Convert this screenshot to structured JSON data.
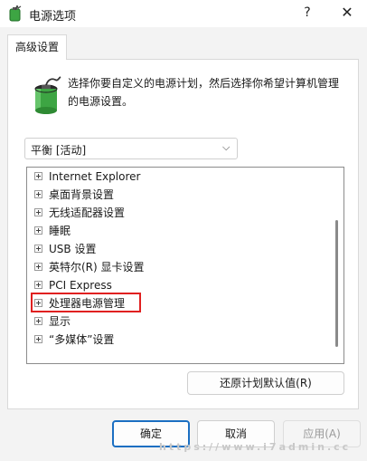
{
  "titlebar": {
    "title": "电源选项",
    "help_label": "?",
    "close_label": "✕"
  },
  "tabs": [
    {
      "label": "高级设置"
    }
  ],
  "description": "选择你要自定义的电源计划，然后选择你希望计算机管理的电源设置。",
  "plan_select": {
    "value": "平衡 [活动]",
    "chevron": "⌵"
  },
  "tree": {
    "items": [
      {
        "label": "Internet Explorer"
      },
      {
        "label": "桌面背景设置"
      },
      {
        "label": "无线适配器设置"
      },
      {
        "label": "睡眠"
      },
      {
        "label": "USB 设置"
      },
      {
        "label": "英特尔(R) 显卡设置"
      },
      {
        "label": "PCI Express"
      },
      {
        "label": "处理器电源管理",
        "highlighted": true
      },
      {
        "label": "显示"
      },
      {
        "label": "“多媒体”设置"
      }
    ]
  },
  "restore_button": "还原计划默认值(R)",
  "footer": {
    "ok_label": "确定",
    "cancel_label": "取消",
    "apply_label": "应用(A)"
  },
  "watermark": "https://www.i7admin.cc",
  "colors": {
    "highlight_border": "#e02020",
    "primary_button_border": "#1b6fc2",
    "battery_green": "#3da543"
  },
  "icons": {
    "app_icon": "battery-power-icon",
    "panel_icon": "battery-power-icon"
  }
}
